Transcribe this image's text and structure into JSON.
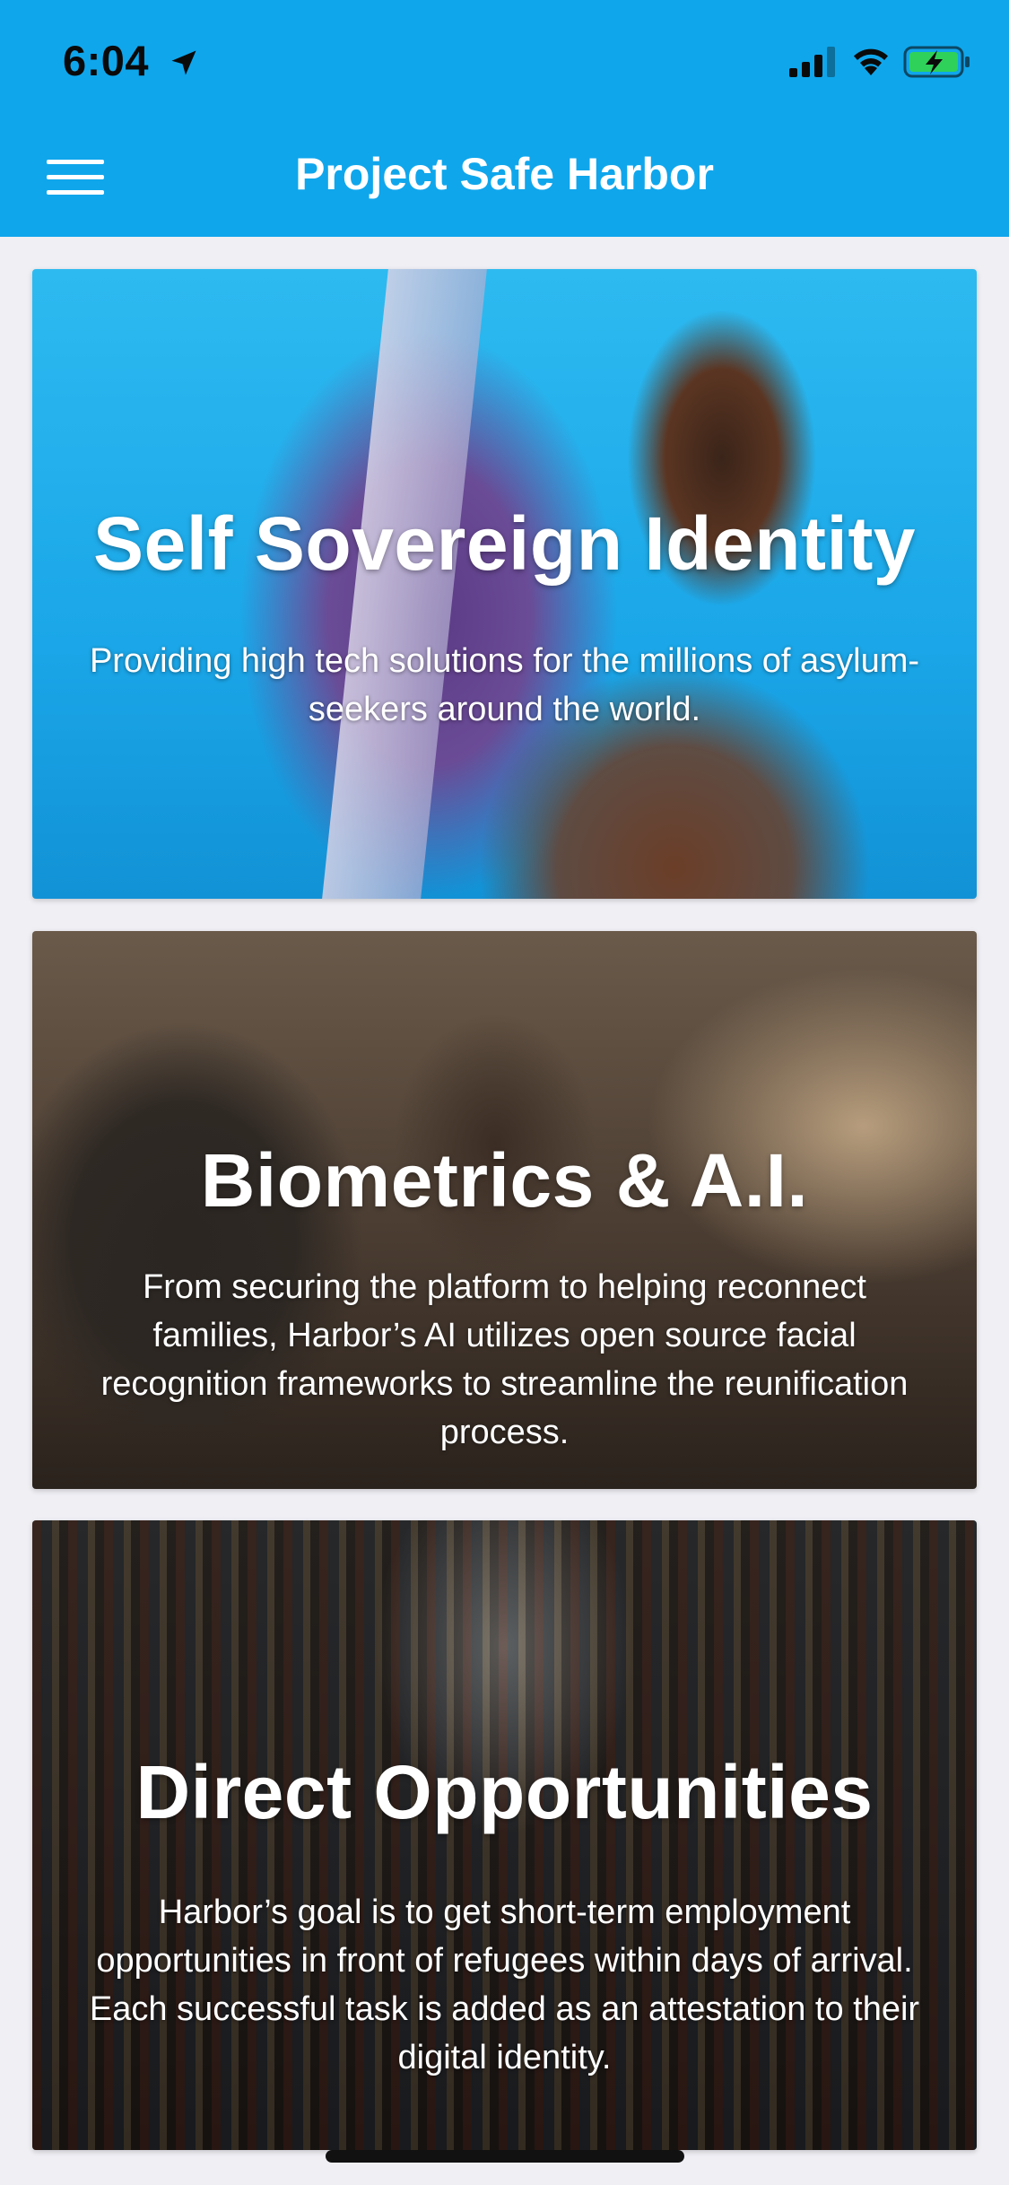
{
  "status_bar": {
    "time": "6:04",
    "icons": [
      "location-arrow-icon",
      "cellular-signal-icon",
      "wifi-icon",
      "battery-charging-icon"
    ]
  },
  "header": {
    "title": "Project Safe Harbor",
    "menu_icon": "hamburger-menu-icon",
    "background_color": "#0fa6ec"
  },
  "cards": [
    {
      "title": "Self Sovereign Identity",
      "text": "Providing high tech solutions for the millions of asylum-seekers around the world."
    },
    {
      "title": "Biometrics & A.I.",
      "text": "From securing the platform to helping reconnect families, Harbor’s AI utilizes open source facial recognition frameworks to streamline the reunification process."
    },
    {
      "title": "Direct Opportunities",
      "text": "Harbor’s goal is to get short-term employment opportunities in front of refugees within days of arrival. Each successful task is added as an attestation to their digital identity."
    }
  ]
}
